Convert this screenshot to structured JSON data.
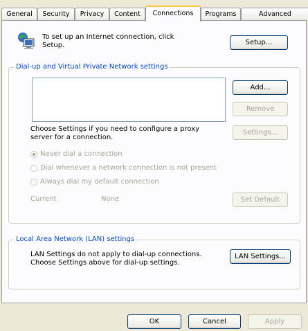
{
  "tabs": [
    "General",
    "Security",
    "Privacy",
    "Content",
    "Connections",
    "Programs",
    "Advanced"
  ],
  "active_tab": "Connections",
  "setup": {
    "line1": "To set up an Internet connection, click",
    "line2": "Setup.",
    "button": "Setup..."
  },
  "dialup_group": {
    "legend": "Dial-up and Virtual Private Network settings",
    "add_button": "Add...",
    "remove_button": "Remove",
    "settings_line1": "Choose Settings if you need to configure a proxy",
    "settings_line2": "server for a connection.",
    "settings_button": "Settings...",
    "radio_never": "Never dial a connection",
    "radio_whenever": "Dial whenever a network connection is not present",
    "radio_always": "Always dial my default connection",
    "current_label": "Current",
    "current_value": "None",
    "set_default_button": "Set Default"
  },
  "lan_group": {
    "legend": "Local Area Network (LAN) settings",
    "line1": "LAN Settings do not apply to dial-up connections.",
    "line2": "Choose Settings above for dial-up settings.",
    "button": "LAN Settings..."
  },
  "footer": {
    "ok": "OK",
    "cancel": "Cancel",
    "apply": "Apply"
  }
}
